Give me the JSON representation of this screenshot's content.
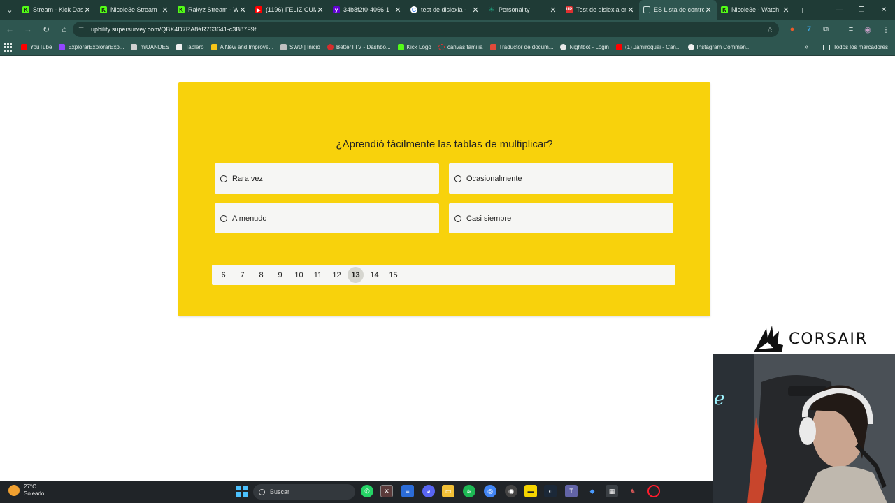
{
  "browser": {
    "tabs": [
      {
        "title": "Stream - Kick Das",
        "favicon": "kick-icon",
        "color": "#53fc18",
        "active": false
      },
      {
        "title": "Nicole3e Stream",
        "favicon": "kick-icon",
        "color": "#53fc18",
        "active": false
      },
      {
        "title": "Rakyz Stream - W",
        "favicon": "kick-icon",
        "color": "#53fc18",
        "active": false
      },
      {
        "title": "(1196) FELIZ CUM",
        "favicon": "youtube-icon",
        "color": "#ff0000",
        "active": false
      },
      {
        "title": "34b8f2f0-4066-1",
        "favicon": "yahoo-icon",
        "color": "#6001d2",
        "active": false
      },
      {
        "title": "test de dislexia - ",
        "favicon": "google-icon",
        "color": "#ffffff",
        "active": false
      },
      {
        "title": "Personality",
        "favicon": "asterisk-icon",
        "color": "#1fa37f",
        "active": false
      },
      {
        "title": "Test de dislexia en",
        "favicon": "up-icon",
        "color": "#e03030",
        "active": false
      },
      {
        "title": "ES Lista de contro",
        "favicon": "page-icon",
        "color": "#8fb0aa",
        "active": true
      },
      {
        "title": "Nicole3e - Watch",
        "favicon": "kick-icon",
        "color": "#53fc18",
        "active": false
      }
    ],
    "url": "upbility.supersurvey.com/QBX4D7RA8#R763641-c3B87F9f",
    "bookmarks": [
      {
        "label": "YouTube",
        "color": "#ff0000"
      },
      {
        "label": "ExplorarExplorarExp...",
        "color": "#9146ff"
      },
      {
        "label": "miUANDES",
        "color": "#d0d0d0"
      },
      {
        "label": "Tablero",
        "color": "#f0f0f0"
      },
      {
        "label": "A New and Improve...",
        "color": "#f5c518"
      },
      {
        "label": "SWD | Inicio",
        "color": "#c0c0c0"
      },
      {
        "label": "BetterTTV - Dashbo...",
        "color": "#d62d2d"
      },
      {
        "label": "Kick Logo",
        "color": "#53fc18"
      },
      {
        "label": "canvas familia",
        "color": "#e03030"
      },
      {
        "label": "Traductor de docum...",
        "color": "#e04a3a"
      },
      {
        "label": "Nightbot - Login",
        "color": "#e8e8e8"
      },
      {
        "label": "(1) Jamiroquai - Can...",
        "color": "#ff0000"
      },
      {
        "label": "Instagram Commen...",
        "color": "#f0f0f0"
      }
    ],
    "all_bookmarks_label": "Todos los marcadores"
  },
  "survey": {
    "question": "¿Aprendió fácilmente las tablas de multiplicar?",
    "options": [
      "Rara vez",
      "Ocasionalmente",
      "A menudo",
      "Casi siempre"
    ],
    "pages": [
      "6",
      "7",
      "8",
      "9",
      "10",
      "11",
      "12",
      "13",
      "14",
      "15"
    ],
    "current_page": "13",
    "card_color": "#f8d20c"
  },
  "overlay": {
    "brand": "CORSAIR"
  },
  "taskbar": {
    "temperature": "27°C",
    "condition": "Soleado",
    "search_placeholder": "Buscar"
  }
}
